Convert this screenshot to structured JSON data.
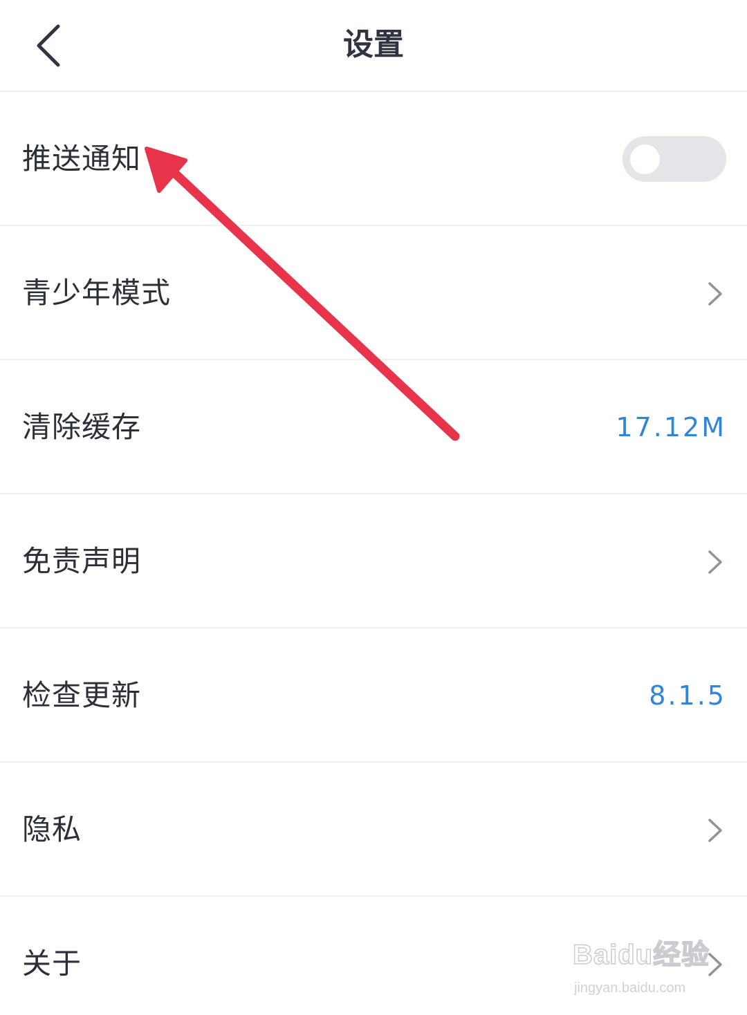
{
  "header": {
    "title": "设置"
  },
  "settings": {
    "push": {
      "label": "推送通知",
      "enabled": false
    },
    "teen_mode": {
      "label": "青少年模式"
    },
    "clear_cache": {
      "label": "清除缓存",
      "value": "17.12M"
    },
    "disclaimer": {
      "label": "免责声明"
    },
    "check_update": {
      "label": "检查更新",
      "value": "8.1.5"
    },
    "privacy": {
      "label": "隐私"
    },
    "about": {
      "label": "关于"
    }
  },
  "watermark": {
    "brand": "Baidu经验",
    "url": "jingyan.baidu.com"
  },
  "colors": {
    "accent": "#2f86d8",
    "annotation_arrow": "#e8344a",
    "toggle_off": "#e4e5e9",
    "text_primary": "#2b2f38"
  },
  "icons": {
    "back": "chevron-left-icon",
    "row_arrow": "chevron-right-icon"
  }
}
